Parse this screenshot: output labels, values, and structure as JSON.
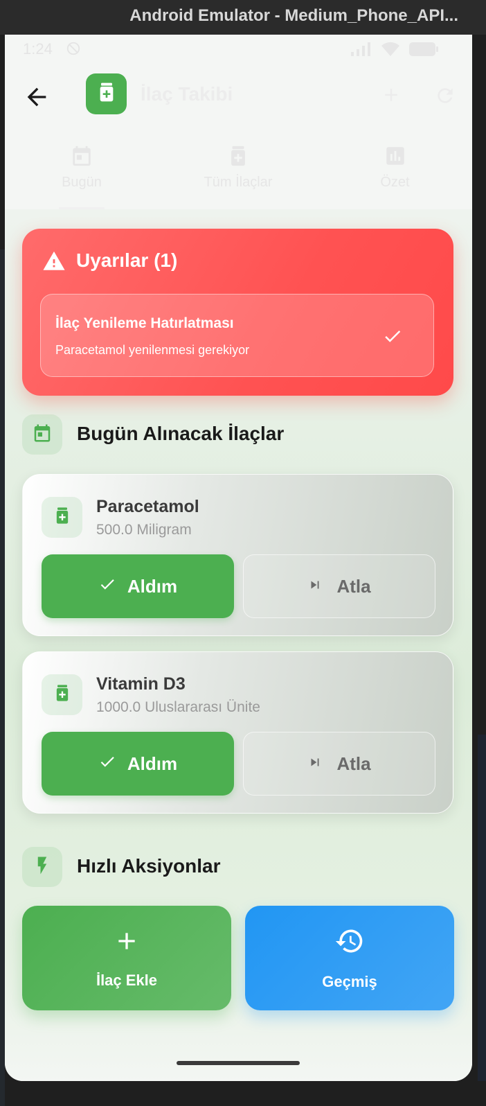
{
  "window": {
    "title": "Android Emulator - Medium_Phone_API..."
  },
  "status_bar": {
    "time": "1:24"
  },
  "app_bar": {
    "title": "İlaç Takibi"
  },
  "tabs": [
    {
      "label": "Bugün",
      "icon": "calendar-today-icon",
      "selected": true
    },
    {
      "label": "Tüm İlaçlar",
      "icon": "medication-icon",
      "selected": false
    },
    {
      "label": "Özet",
      "icon": "chart-icon",
      "selected": false
    }
  ],
  "alerts": {
    "title": "Uyarılar (1)",
    "items": [
      {
        "title": "İlaç Yenileme Hatırlatması",
        "message": "Paracetamol yenilenmesi gerekiyor"
      }
    ]
  },
  "today_section": {
    "title": "Bugün Alınacak İlaçlar"
  },
  "medications": [
    {
      "name": "Paracetamol",
      "dose": "500.0 Miligram",
      "take_label": "Aldım",
      "skip_label": "Atla"
    },
    {
      "name": "Vitamin D3",
      "dose": "1000.0 Uluslararası Ünite",
      "take_label": "Aldım",
      "skip_label": "Atla"
    }
  ],
  "quick_actions": {
    "title": "Hızlı Aksiyonlar",
    "add_label": "İlaç Ekle",
    "history_label": "Geçmiş"
  },
  "colors": {
    "primary_green": "#4caf50",
    "alert_red": "#ff5252",
    "history_blue": "#2196f3"
  }
}
